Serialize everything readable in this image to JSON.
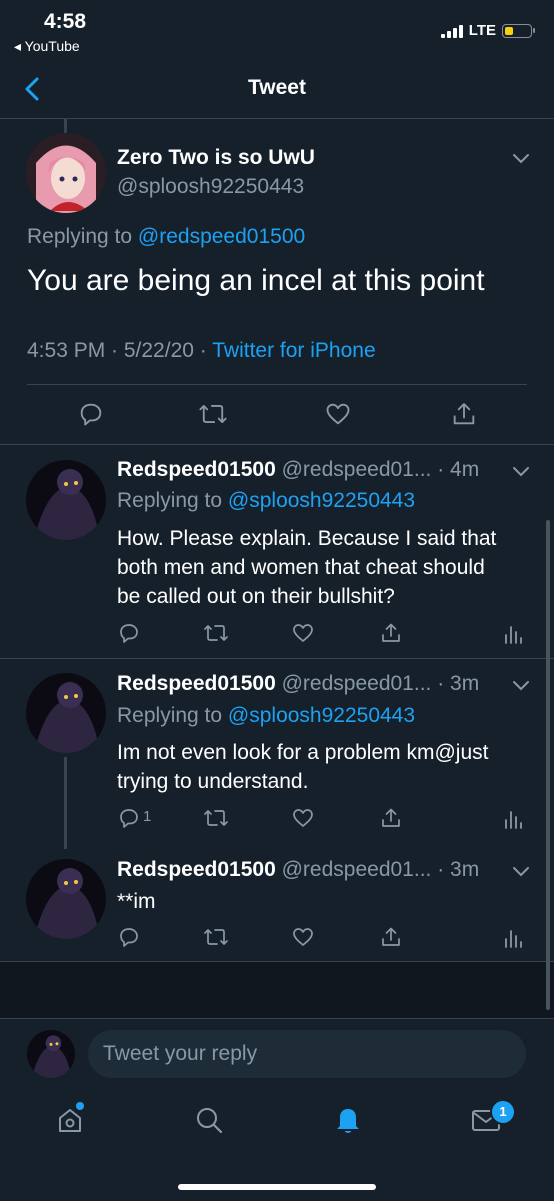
{
  "status_bar": {
    "time": "4:58",
    "back_app": "◂ YouTube",
    "network": "LTE",
    "battery_level": 0.35
  },
  "header": {
    "title": "Tweet"
  },
  "main_tweet": {
    "name": "Zero Two is so UwU",
    "handle": "@sploosh92250443",
    "replying_prefix": "Replying to",
    "replying_to": "@redspeed01500",
    "text": "You are being an incel at this point",
    "timestamp": "4:53 PM · 5/22/20 ·",
    "client": "Twitter for iPhone"
  },
  "replies": [
    {
      "name": "Redspeed01500",
      "handle": "@redspeed01...",
      "time": "· 4m",
      "replying_prefix": "Replying to",
      "replying_to": "@sploosh92250443",
      "text_lines": [
        "How. Please explain. Because I said that",
        "both men and women that cheat should",
        "be called out on their bullshit?"
      ],
      "reply_count": ""
    },
    {
      "name": "Redspeed01500",
      "handle": "@redspeed01...",
      "time": "· 3m",
      "replying_prefix": "Replying to",
      "replying_to": "@sploosh92250443",
      "text_lines": [
        "Im not even look for a problem km@just",
        "trying to understand."
      ],
      "reply_count": "1"
    },
    {
      "name": "Redspeed01500",
      "handle": "@redspeed01...",
      "time": "· 3m",
      "text_lines": [
        "**im"
      ],
      "reply_count": ""
    }
  ],
  "composer": {
    "placeholder": "Tweet your reply"
  },
  "tab_bar": {
    "messages_badge": "1"
  },
  "colors": {
    "background": "#15202b",
    "accent": "#1da1f2",
    "muted": "#8899a6",
    "divider": "#38444d"
  },
  "icons": [
    "back-arrow-icon",
    "chevron-down-icon",
    "reply-icon",
    "retweet-icon",
    "like-icon",
    "share-icon",
    "analytics-icon",
    "home-icon",
    "search-icon",
    "notifications-icon",
    "messages-icon"
  ]
}
